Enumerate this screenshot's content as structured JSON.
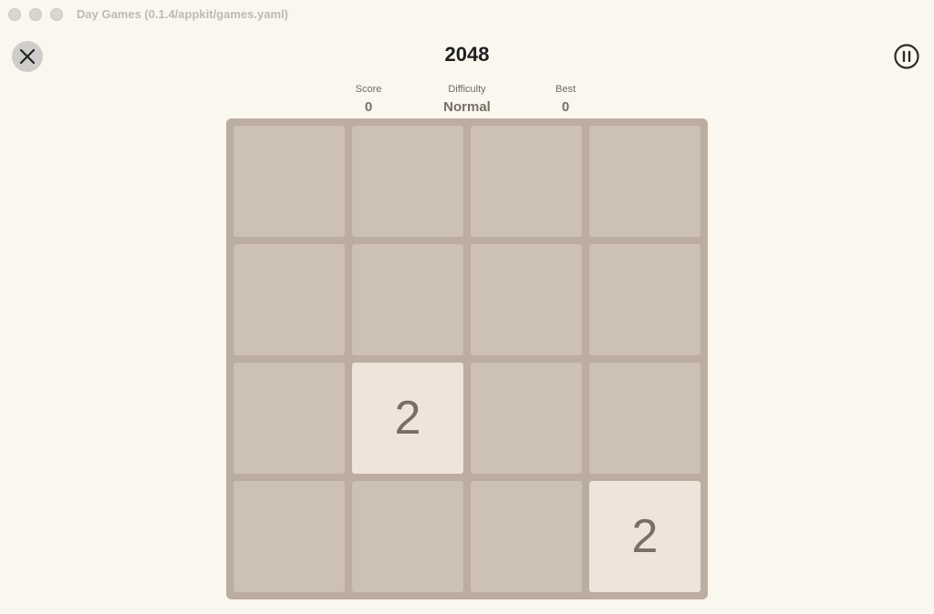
{
  "window": {
    "title": "Day Games (0.1.4/appkit/games.yaml)"
  },
  "header": {
    "title": "2048",
    "close_icon": "close-x-icon",
    "pause_icon": "pause-circle-icon"
  },
  "stats": {
    "score_label": "Score",
    "score_value": "0",
    "difficulty_label": "Difficulty",
    "difficulty_value": "Normal",
    "best_label": "Best",
    "best_value": "0"
  },
  "board": {
    "size": 4,
    "cells": [
      [
        "",
        "",
        "",
        ""
      ],
      [
        "",
        "",
        "",
        ""
      ],
      [
        "",
        "2",
        "",
        ""
      ],
      [
        "",
        "",
        "",
        "2"
      ]
    ]
  },
  "colors": {
    "background": "#faf7ef",
    "board": "#bbada0",
    "empty_cell": "#cdc1b4",
    "tile_2": "#eee4da",
    "tile_text": "#776e65"
  }
}
